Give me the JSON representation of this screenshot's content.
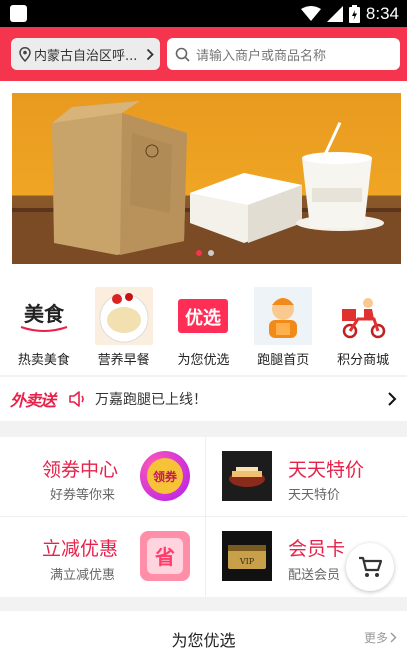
{
  "status_bar": {
    "time": "8:34"
  },
  "header": {
    "location": "内蒙古自治区呼...",
    "search_placeholder": "请输入商户或商品名称"
  },
  "banner": {
    "slides": 2,
    "active_index": 0
  },
  "categories": [
    {
      "label": "热卖美食",
      "icon": "meishi-icon",
      "art_text": "美食"
    },
    {
      "label": "营养早餐",
      "icon": "breakfast-photo"
    },
    {
      "label": "为您优选",
      "icon": "youxuan-icon",
      "art_text": "优选"
    },
    {
      "label": "跑腿首页",
      "icon": "courier-icon"
    },
    {
      "label": "积分商城",
      "icon": "delivery-scooter-icon"
    }
  ],
  "notice": {
    "brand": "外卖送",
    "message": "万嘉跑腿已上线！"
  },
  "promo": {
    "coupon": {
      "title": "领券中心",
      "subtitle": "好券等你来",
      "badge": "领券"
    },
    "daily": {
      "title": "天天特价",
      "subtitle": "天天特价"
    },
    "discount": {
      "title": "立减优惠",
      "subtitle": "满立减优惠",
      "badge": "省"
    },
    "member": {
      "title": "会员卡",
      "subtitle": "配送会员"
    }
  },
  "section": {
    "title": "为您优选",
    "more": "更多"
  },
  "colors": {
    "primary": "#f5354d",
    "accent_text": "#e8214a",
    "background": "#f2f2f2"
  }
}
